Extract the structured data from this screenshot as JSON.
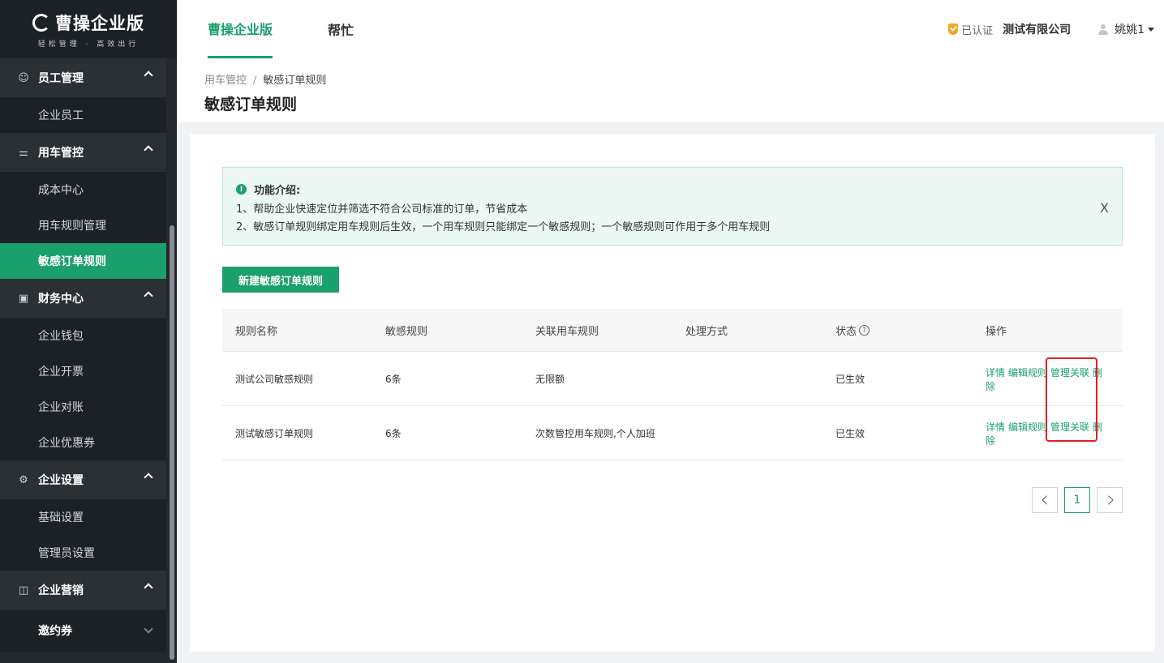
{
  "brand": {
    "name": "曹操企业版",
    "slogan": "轻松管理 · 高效出行"
  },
  "sidebar": {
    "groups": [
      {
        "label": "员工管理",
        "items": [
          "企业员工"
        ]
      },
      {
        "label": "用车管控",
        "items": [
          "成本中心",
          "用车规则管理",
          "敏感订单规则"
        ]
      },
      {
        "label": "财务中心",
        "items": [
          "企业钱包",
          "企业开票",
          "企业对账",
          "企业优惠券"
        ]
      },
      {
        "label": "企业设置",
        "items": [
          "基础设置",
          "管理员设置"
        ]
      },
      {
        "label": "企业营销",
        "items": [
          "邀约券"
        ]
      }
    ],
    "active_item": "敏感订单规则"
  },
  "header": {
    "tabs": [
      "曹操企业版",
      "帮忙"
    ],
    "verified": "已认证",
    "company": "测试有限公司",
    "user": "姚姚1"
  },
  "breadcrumb": {
    "parent": "用车管控",
    "separator": "/",
    "current": "敏感订单规则"
  },
  "page_title": "敏感订单规则",
  "notice": {
    "title": "功能介绍:",
    "lines": [
      "1、帮助企业快速定位并筛选不符合公司标准的订单，节省成本",
      "2、敏感订单规则绑定用车规则后生效，一个用车规则只能绑定一个敏感规则；一个敏感规则可作用于多个用车规则"
    ],
    "close": "X"
  },
  "new_button": "新建敏感订单规则",
  "table": {
    "columns": [
      "规则名称",
      "敏感规则",
      "关联用车规则",
      "处理方式",
      "状态",
      "操作"
    ],
    "status_help": "?",
    "rows": [
      {
        "name": "测试公司敏感规则",
        "rules": "6条",
        "linked": "无限额",
        "handling": "",
        "status": "已生效"
      },
      {
        "name": "测试敏感订单规则",
        "rules": "6条",
        "linked": "次数管控用车规则,个人加班",
        "handling": "",
        "status": "已生效"
      }
    ],
    "actions": {
      "detail": "详情",
      "edit": "编辑规则",
      "manage": "管理关联",
      "delete": "删除"
    }
  },
  "pagination": {
    "current": "1"
  },
  "colors": {
    "accent": "#1aa06d",
    "sidebar": "#23282d",
    "highlight": "#e02020"
  }
}
